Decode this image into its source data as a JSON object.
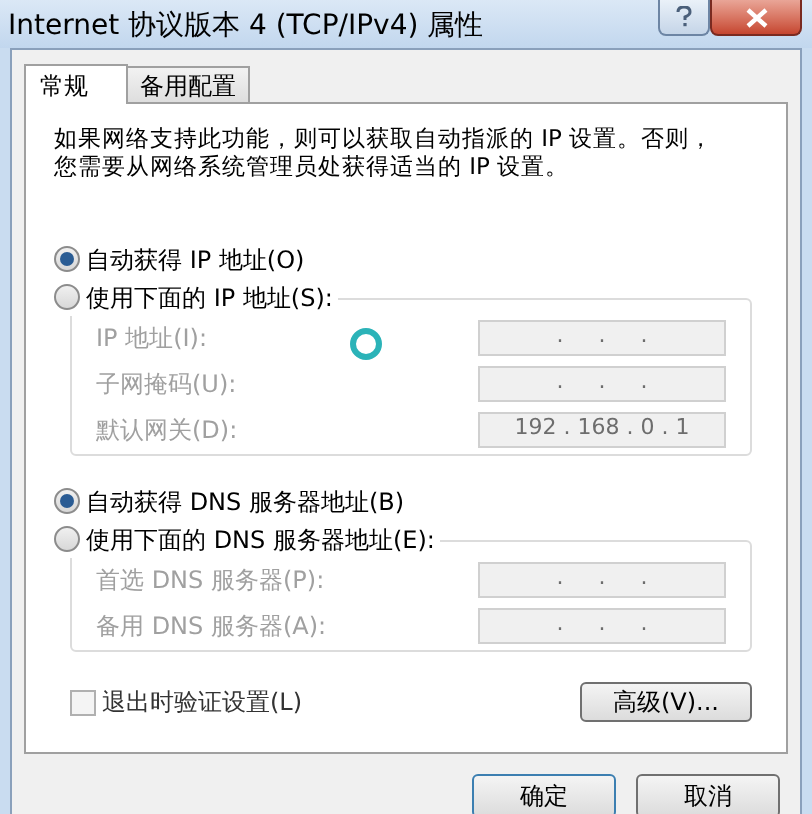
{
  "window": {
    "title": "Internet 协议版本 4 (TCP/IPv4) 属性",
    "title_buttons": [
      {
        "kind": "help"
      },
      {
        "kind": "close"
      }
    ]
  },
  "tabs": [
    {
      "label": "常规",
      "selected": true
    },
    {
      "label": "备用配置",
      "selected": false
    }
  ],
  "description": "如果网络支持此功能，则可以获取自动指派的 IP 设置。否则，您需要从网络系统管理员处获得适当的 IP 设置。",
  "ip_options": [
    {
      "label": "自动获得 IP 地址(O)",
      "selected": true
    },
    {
      "label": "使用下面的 IP 地址(S):",
      "selected": false
    }
  ],
  "ip_fields": [
    {
      "label": "IP 地址(I):",
      "value": ".     .     .",
      "disabled": true
    },
    {
      "label": "子网掩码(U):",
      "value": ".     .     .",
      "disabled": true
    },
    {
      "label": "默认网关(D):",
      "value": "192 . 168 . 0 . 1",
      "disabled": true
    }
  ],
  "dns_options": [
    {
      "label": "自动获得 DNS 服务器地址(B)",
      "selected": true
    },
    {
      "label": "使用下面的 DNS 服务器地址(E):",
      "selected": false
    }
  ],
  "dns_fields": [
    {
      "label": "首选 DNS 服务器(P):",
      "value": ".     .     .",
      "disabled": true
    },
    {
      "label": "备用 DNS 服务器(A):",
      "value": ".     .     .",
      "disabled": true
    }
  ],
  "validate_checkbox": {
    "label": "退出时验证设置(L)",
    "checked": false
  },
  "advanced_button": "高级(V)...",
  "buttons": [
    "确定",
    "取消"
  ]
}
